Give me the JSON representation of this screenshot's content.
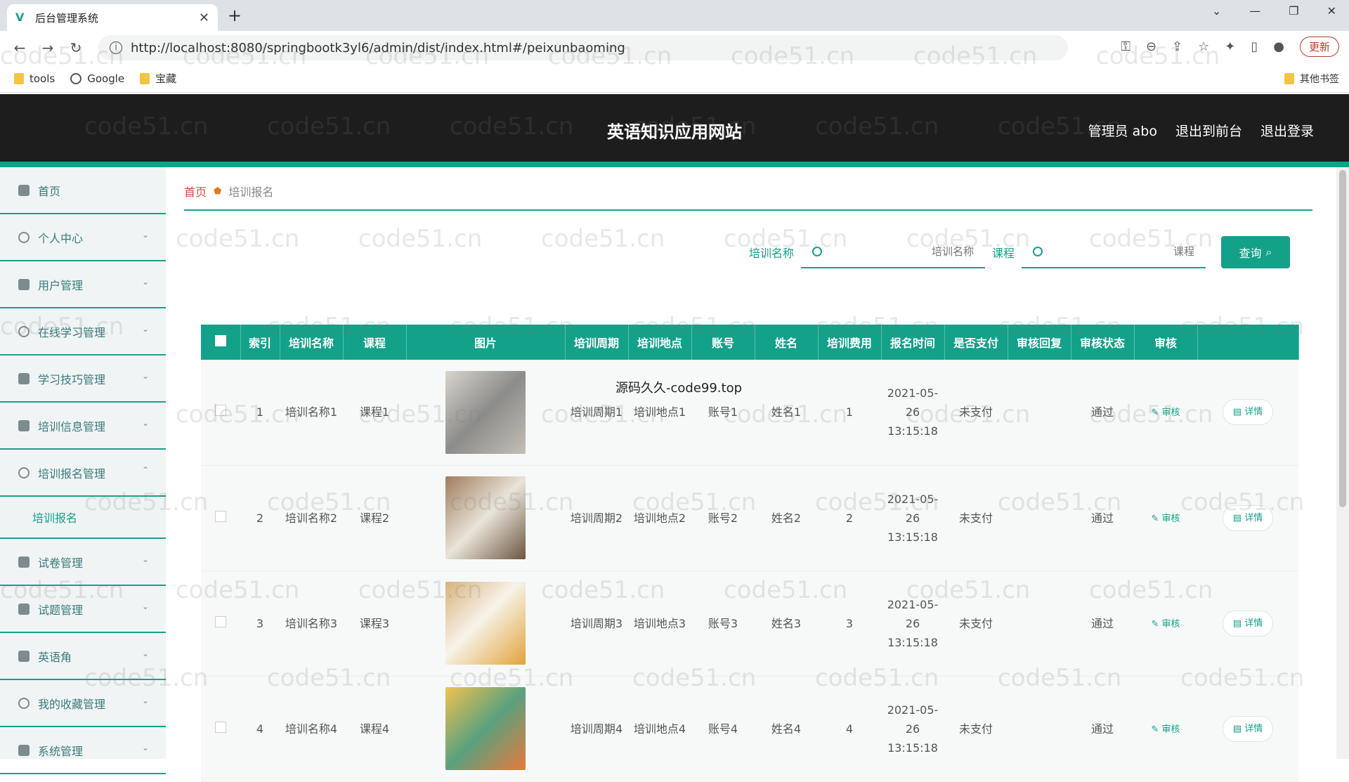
{
  "browser": {
    "tab_title": "后台管理系统",
    "url": "http://localhost:8080/springbootk3yl6/admin/dist/index.html#/peixunbaoming",
    "update_label": "更新",
    "bookmarks": [
      "tools",
      "Google",
      "宝藏"
    ],
    "other_bookmarks": "其他书签"
  },
  "header": {
    "site_title": "英语知识应用网站",
    "admin_label": "管理员 abo",
    "to_front": "退出到前台",
    "logout": "退出登录"
  },
  "sidebar": {
    "items": [
      {
        "label": "首页",
        "icon": "home-icon"
      },
      {
        "label": "个人中心",
        "icon": "user-icon"
      },
      {
        "label": "用户管理",
        "icon": "users-icon"
      },
      {
        "label": "在线学习管理",
        "icon": "study-icon"
      },
      {
        "label": "学习技巧管理",
        "icon": "tips-icon"
      },
      {
        "label": "培训信息管理",
        "icon": "info-icon"
      },
      {
        "label": "培训报名管理",
        "icon": "location-icon"
      }
    ],
    "active_sub": "培训报名",
    "items_after": [
      {
        "label": "试卷管理",
        "icon": "paper-icon"
      },
      {
        "label": "试题管理",
        "icon": "question-icon"
      },
      {
        "label": "英语角",
        "icon": "chart-icon"
      },
      {
        "label": "我的收藏管理",
        "icon": "favorite-icon"
      },
      {
        "label": "系统管理",
        "icon": "system-icon"
      }
    ]
  },
  "breadcrumb": {
    "home": "首页",
    "current": "培训报名"
  },
  "search": {
    "label1": "培训名称",
    "placeholder1": "培训名称",
    "label2": "课程",
    "placeholder2": "课程",
    "button": "查询"
  },
  "table": {
    "headers": [
      "索引",
      "培训名称",
      "课程",
      "图片",
      "培训周期",
      "培训地点",
      "账号",
      "姓名",
      "培训费用",
      "报名时间",
      "是否支付",
      "审核回复",
      "审核状态",
      "审核"
    ],
    "rows": [
      {
        "index": "1",
        "name": "培训名称1",
        "course": "课程1",
        "cycle": "培训周期1",
        "place": "培训地点1",
        "account": "账号1",
        "person": "姓名1",
        "fee": "1",
        "time": "2021-05-26 13:15:18",
        "paid": "未支付",
        "reply": "",
        "status": "通过",
        "review": "审核",
        "detail": "详情"
      },
      {
        "index": "2",
        "name": "培训名称2",
        "course": "课程2",
        "cycle": "培训周期2",
        "place": "培训地点2",
        "account": "账号2",
        "person": "姓名2",
        "fee": "2",
        "time": "2021-05-26 13:15:18",
        "paid": "未支付",
        "reply": "",
        "status": "通过",
        "review": "审核",
        "detail": "详情"
      },
      {
        "index": "3",
        "name": "培训名称3",
        "course": "课程3",
        "cycle": "培训周期3",
        "place": "培训地点3",
        "account": "账号3",
        "person": "姓名3",
        "fee": "3",
        "time": "2021-05-26 13:15:18",
        "paid": "未支付",
        "reply": "",
        "status": "通过",
        "review": "审核",
        "detail": "详情"
      },
      {
        "index": "4",
        "name": "培训名称4",
        "course": "课程4",
        "cycle": "培训周期4",
        "place": "培训地点4",
        "account": "账号4",
        "person": "姓名4",
        "fee": "4",
        "time": "2021-05-26 13:15:18",
        "paid": "未支付",
        "reply": "",
        "status": "通过",
        "review": "审核",
        "detail": "详情"
      }
    ]
  },
  "overlay_text": "源码久久-code99.top",
  "watermark": "code51.cn",
  "colors": {
    "accent": "#13a18a",
    "header_bg": "#1d1d1d",
    "danger": "#e0443c"
  }
}
